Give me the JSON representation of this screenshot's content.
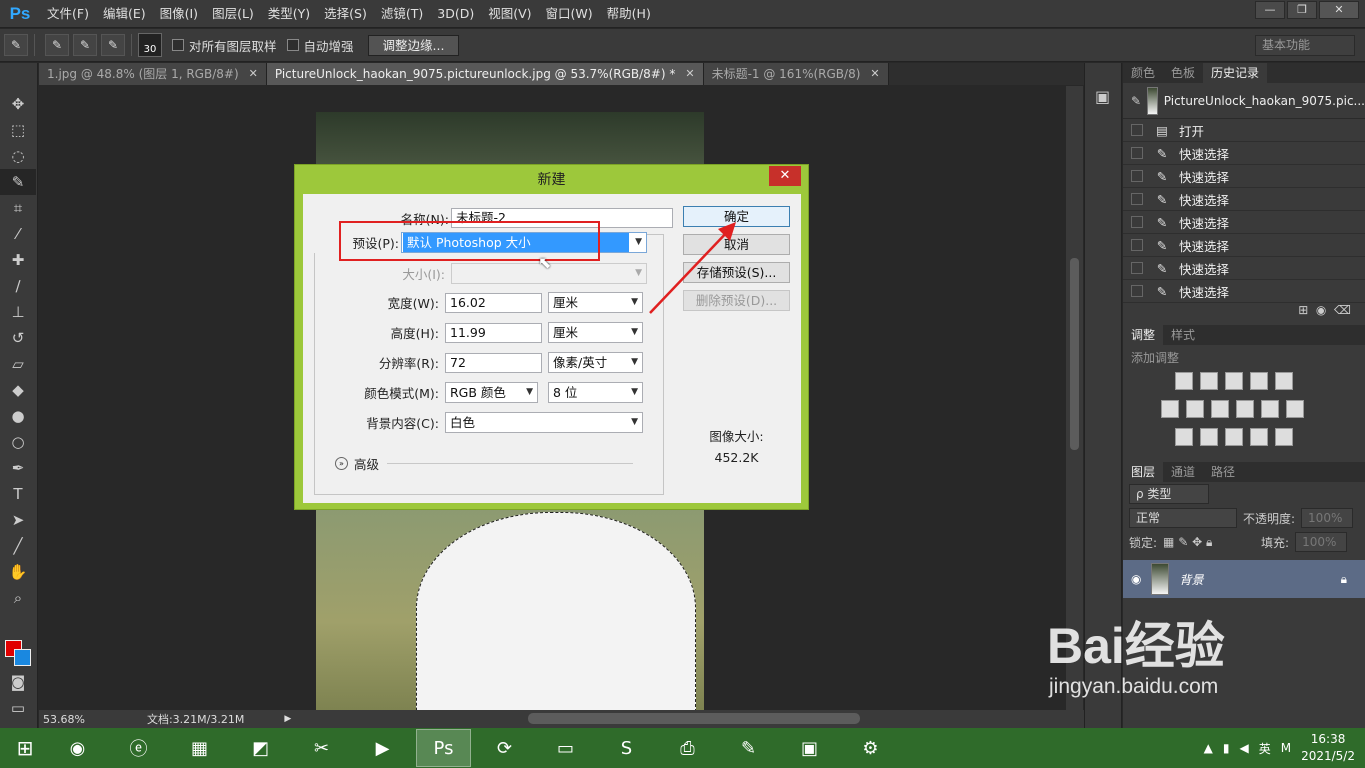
{
  "app": {
    "logo": "Ps"
  },
  "menu": [
    "文件(F)",
    "编辑(E)",
    "图像(I)",
    "图层(L)",
    "类型(Y)",
    "选择(S)",
    "滤镜(T)",
    "3D(D)",
    "视图(V)",
    "窗口(W)",
    "帮助(H)"
  ],
  "options": {
    "brush_size": "30",
    "sample_all_label": "对所有图层取样",
    "auto_enhance_label": "自动增强",
    "refine_edge_label": "调整边缘...",
    "workspace": "基本功能"
  },
  "tabs": [
    {
      "label": "1.jpg @ 48.8% (图层 1, RGB/8#)",
      "active": false
    },
    {
      "label": "PictureUnlock_haokan_9075.pictureunlock.jpg @ 53.7%(RGB/8#) *",
      "active": true
    },
    {
      "label": "未标题-1 @ 161%(RGB/8)",
      "active": false
    }
  ],
  "status": {
    "zoom": "53.68%",
    "doc": "文档:3.21M/3.21M"
  },
  "dialog": {
    "title": "新建",
    "name_label": "名称(N):",
    "name_value": "未标题-2",
    "preset_label": "预设(P):",
    "preset_value": "默认 Photoshop 大小",
    "size_label": "大小(I):",
    "width_label": "宽度(W):",
    "width_value": "16.02",
    "width_unit": "厘米",
    "height_label": "高度(H):",
    "height_value": "11.99",
    "height_unit": "厘米",
    "res_label": "分辨率(R):",
    "res_value": "72",
    "res_unit": "像素/英寸",
    "mode_label": "颜色模式(M):",
    "mode_value": "RGB 颜色",
    "mode_bits": "8 位",
    "bg_label": "背景内容(C):",
    "bg_value": "白色",
    "advanced_label": "高级",
    "ok_label": "确定",
    "cancel_label": "取消",
    "save_preset_label": "存储预设(S)...",
    "delete_preset_label": "删除预设(D)...",
    "image_size_label": "图像大小:",
    "image_size_value": "452.2K"
  },
  "panels": {
    "top_tabs": [
      "颜色",
      "色板",
      "历史记录"
    ],
    "history_source": "PictureUnlock_haokan_9075.pic...",
    "history": [
      "打开",
      "快速选择",
      "快速选择",
      "快速选择",
      "快速选择",
      "快速选择",
      "快速选择",
      "快速选择"
    ],
    "adj_tabs": [
      "调整",
      "样式"
    ],
    "add_adjustment": "添加调整",
    "layer_tabs": [
      "图层",
      "通道",
      "路径"
    ],
    "filter_kind": "ρ 类型",
    "blend_mode": "正常",
    "opacity_label": "不透明度:",
    "opacity_value": "100%",
    "lock_label": "锁定:",
    "fill_label": "填充:",
    "fill_value": "100%",
    "layer_name": "背景"
  },
  "taskbar": {
    "ime": "英",
    "ime2": "M",
    "time": "16:38",
    "date": "2021/5/2"
  },
  "watermark": {
    "brand": "Bai经验",
    "url": "jingyan.baidu.com"
  },
  "colors": {
    "foreground": "#e00000",
    "background": "#1a88e0",
    "dialog_frame": "#9dc83b",
    "highlight": "#3399ff"
  }
}
